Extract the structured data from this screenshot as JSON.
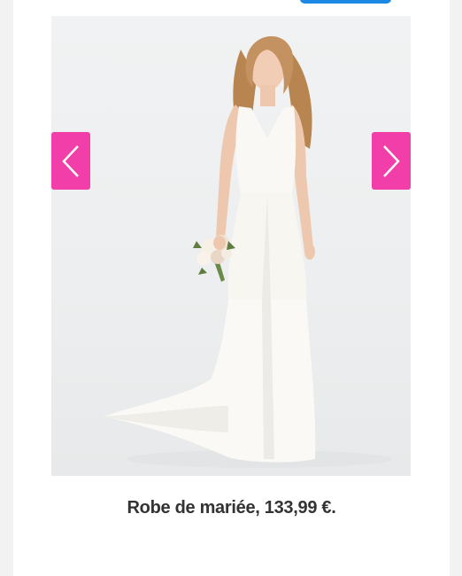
{
  "product": {
    "caption": "Robe de mariée, 133,99 €."
  },
  "gallery": {
    "image_semantic": "wedding-dress-photo",
    "prev_icon": "chevron-left-icon",
    "next_icon": "chevron-right-icon"
  },
  "colors": {
    "arrow_background": "#f23ea8",
    "top_button": "#1e88e5",
    "caption_text": "#333333"
  }
}
